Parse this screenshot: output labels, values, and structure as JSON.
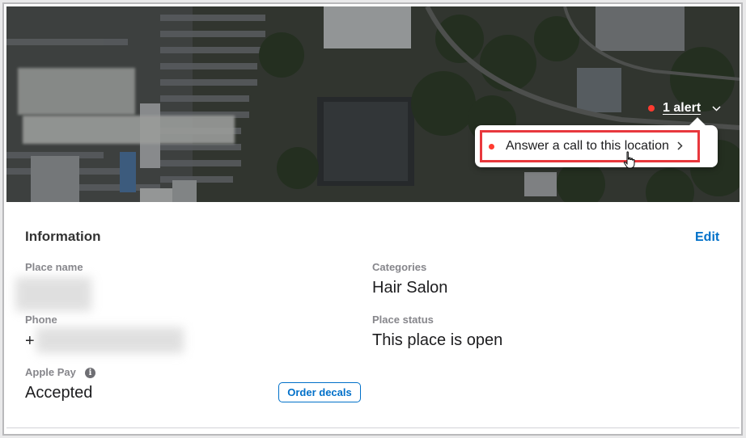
{
  "header": {
    "alert": {
      "label": "1 alert",
      "dot_color": "#ff3b30",
      "chevron": "chevron-down-icon"
    },
    "popover": {
      "item_label": "Answer a call to this location",
      "chevron": "chevron-right-icon"
    }
  },
  "information": {
    "title": "Information",
    "edit_label": "Edit",
    "fields": {
      "place_name": {
        "label": "Place name"
      },
      "phone": {
        "label": "Phone",
        "prefix": "+"
      },
      "apple_pay": {
        "label": "Apple Pay",
        "value": "Accepted",
        "info_glyph": "i"
      },
      "categories": {
        "label": "Categories",
        "value": "Hair Salon"
      },
      "place_status": {
        "label": "Place status",
        "value": "This place is open"
      }
    },
    "order_decals_label": "Order decals"
  },
  "colors": {
    "accent_blue": "#0070c9",
    "alert_red": "#ff3b30",
    "highlight_red": "#e8383d"
  }
}
